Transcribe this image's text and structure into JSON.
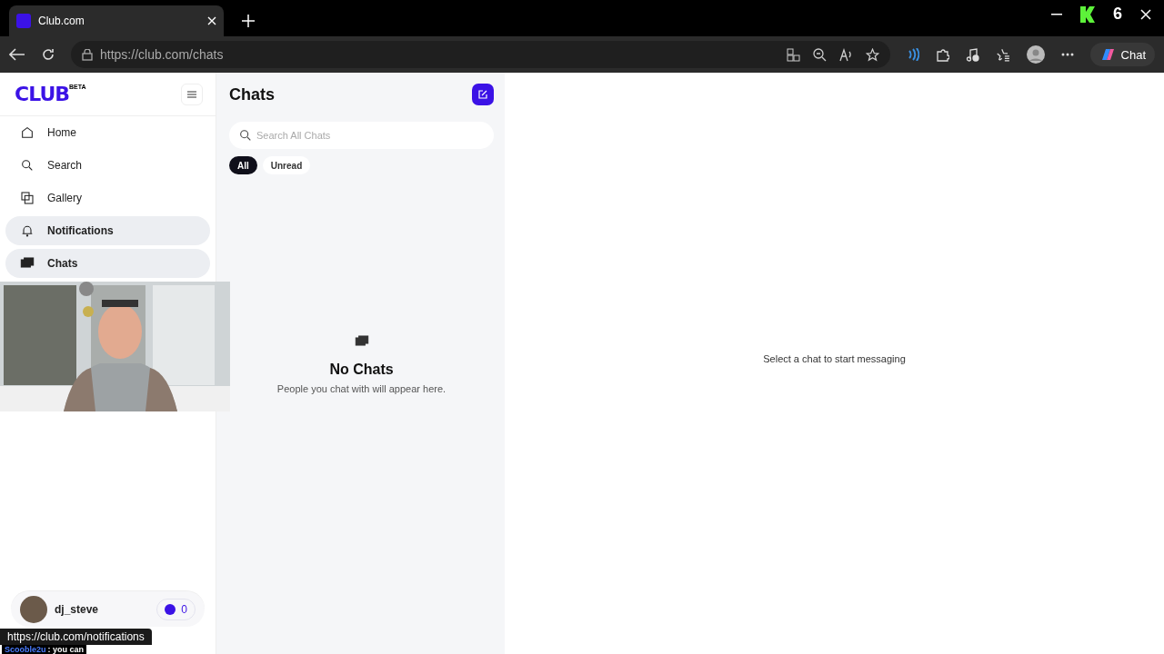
{
  "browser": {
    "tab_title": "Club.com",
    "url_host": "https://club.com",
    "url_path": "/chats",
    "copilot_label": "Chat",
    "overlay_count": "6"
  },
  "sidebar": {
    "logo": "CLUB",
    "logo_badge": "BETA",
    "items": [
      {
        "label": "Home",
        "selected": false
      },
      {
        "label": "Search",
        "selected": false
      },
      {
        "label": "Gallery",
        "selected": false
      },
      {
        "label": "Notifications",
        "selected": true
      },
      {
        "label": "Chats",
        "selected": true
      }
    ],
    "user": {
      "name": "dj_steve",
      "credits": "0"
    }
  },
  "chats": {
    "title": "Chats",
    "search": {
      "placeholder": "Search All Chats"
    },
    "filters": [
      {
        "label": "All",
        "selected": true
      },
      {
        "label": "Unread",
        "selected": false
      }
    ],
    "empty_title": "No Chats",
    "empty_text": "People you chat with will appear here."
  },
  "main": {
    "hint": "Select a chat to start messaging"
  },
  "status_link": "https://club.com/notifications",
  "stream_chat": {
    "user": "Scooble2u",
    "message": ": you can"
  }
}
